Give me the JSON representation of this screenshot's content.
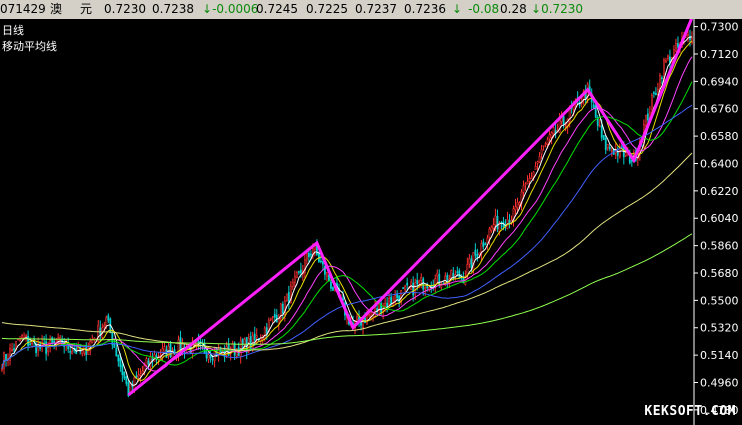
{
  "quote_bar": {
    "code": "071429",
    "name1": "澳",
    "name2": "元",
    "v1": "0.7230",
    "v2": "0.7238",
    "change": "-0.0006",
    "v3": "0.7245",
    "v4": "0.7225",
    "v5": "0.7237",
    "v6": "0.7236",
    "pct": "-0.08",
    "v7": "0.28",
    "last": "0.7230"
  },
  "legend": {
    "period": "日线",
    "indicator": "移动平均线"
  },
  "watermark": "KEKSOFT.COM",
  "colors": {
    "candle_up": "#ff3030",
    "candle_down": "#00d0d0",
    "ma5": "#ffffff",
    "ma10": "#e8e000",
    "ma20": "#ff40ff",
    "ma30": "#00e000",
    "ma60": "#4060ff",
    "ma120": "#e0e080",
    "ma250": "#90ff50",
    "zigzag": "#ff20ff",
    "axis": "#ffffff"
  },
  "chart_data": {
    "type": "candlestick",
    "y_ticks": [
      "0.7300",
      "0.7120",
      "0.6940",
      "0.6760",
      "0.6580",
      "0.6400",
      "0.6220",
      "0.6040",
      "0.5860",
      "0.5680",
      "0.5500",
      "0.5320",
      "0.5140",
      "0.4960",
      "0.4780"
    ],
    "ylim": [
      0.472,
      0.735
    ],
    "n_bars": 345,
    "close_path": [
      {
        "i": 0,
        "v": 0.51
      },
      {
        "i": 10,
        "v": 0.525
      },
      {
        "i": 20,
        "v": 0.518
      },
      {
        "i": 30,
        "v": 0.522
      },
      {
        "i": 40,
        "v": 0.515
      },
      {
        "i": 52,
        "v": 0.537
      },
      {
        "i": 63,
        "v": 0.49
      },
      {
        "i": 75,
        "v": 0.513
      },
      {
        "i": 90,
        "v": 0.52
      },
      {
        "i": 110,
        "v": 0.515
      },
      {
        "i": 125,
        "v": 0.522
      },
      {
        "i": 140,
        "v": 0.545
      },
      {
        "i": 155,
        "v": 0.585
      },
      {
        "i": 162,
        "v": 0.566
      },
      {
        "i": 175,
        "v": 0.533
      },
      {
        "i": 190,
        "v": 0.547
      },
      {
        "i": 210,
        "v": 0.562
      },
      {
        "i": 230,
        "v": 0.566
      },
      {
        "i": 245,
        "v": 0.6
      },
      {
        "i": 255,
        "v": 0.606
      },
      {
        "i": 270,
        "v": 0.65
      },
      {
        "i": 292,
        "v": 0.688
      },
      {
        "i": 300,
        "v": 0.652
      },
      {
        "i": 315,
        "v": 0.643
      },
      {
        "i": 330,
        "v": 0.705
      },
      {
        "i": 344,
        "v": 0.727
      }
    ],
    "moving_averages": [
      {
        "name": "MA5",
        "color_key": "ma5",
        "period": 5
      },
      {
        "name": "MA10",
        "color_key": "ma10",
        "period": 10
      },
      {
        "name": "MA20",
        "color_key": "ma20",
        "period": 20
      },
      {
        "name": "MA30",
        "color_key": "ma30",
        "period": 30
      },
      {
        "name": "MA60",
        "color_key": "ma60",
        "period": 60
      },
      {
        "name": "MA120",
        "color_key": "ma120",
        "period": 120
      },
      {
        "name": "MA250",
        "color_key": "ma250",
        "period": 250
      }
    ],
    "zigzag": [
      {
        "i": 63,
        "v": 0.4878
      },
      {
        "i": 157,
        "v": 0.5878
      },
      {
        "i": 175,
        "v": 0.532
      },
      {
        "i": 292,
        "v": 0.6885
      },
      {
        "i": 315,
        "v": 0.642
      },
      {
        "i": 344,
        "v": 0.736
      }
    ]
  }
}
